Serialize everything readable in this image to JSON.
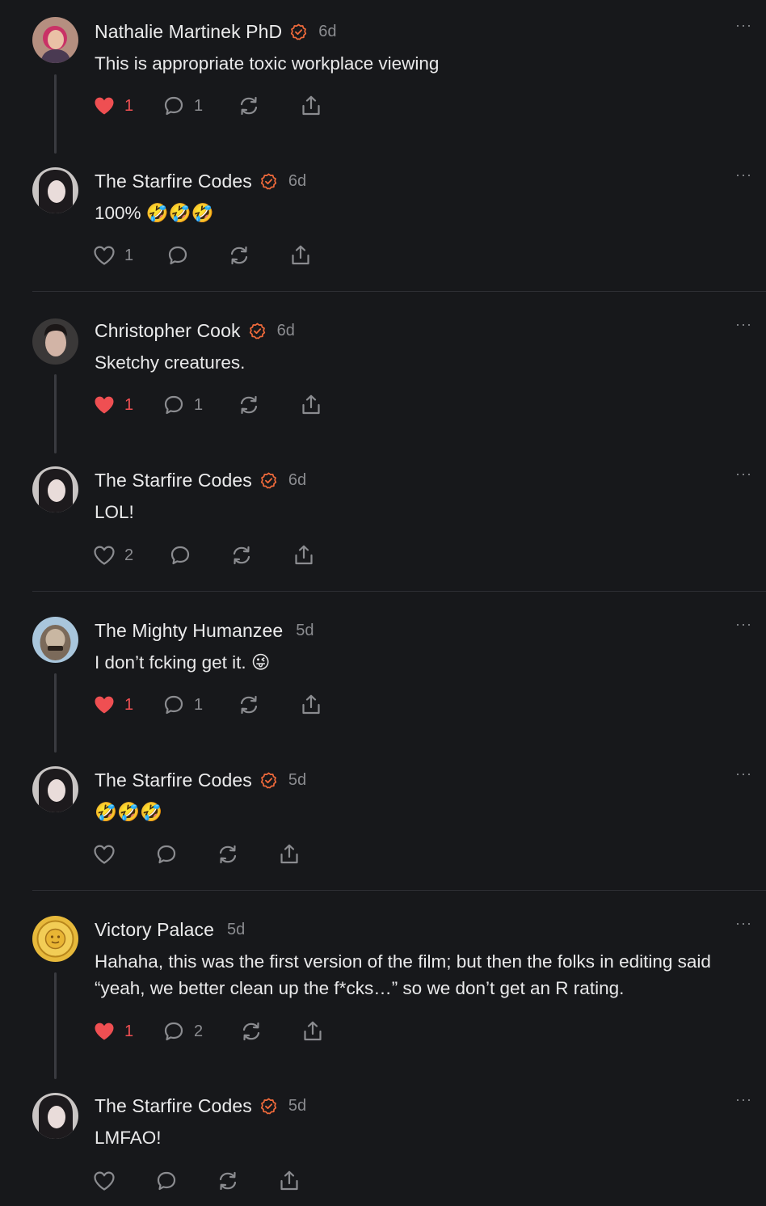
{
  "accent": "#f06a3b",
  "like_color": "#ef4f52",
  "comments": [
    {
      "author": "Nathalie Martinek PhD",
      "verified": true,
      "time": "6d",
      "text": "This is appropriate toxic workplace viewing",
      "liked": true,
      "likes": "1",
      "replies": "1"
    },
    {
      "author": "The Starfire Codes",
      "verified": true,
      "time": "6d",
      "text": "100% 🤣🤣🤣",
      "liked": false,
      "likes": "1",
      "replies": ""
    },
    {
      "author": "Christopher Cook",
      "verified": true,
      "time": "6d",
      "text": "Sketchy creatures.",
      "liked": true,
      "likes": "1",
      "replies": "1"
    },
    {
      "author": "The Starfire Codes",
      "verified": true,
      "time": "6d",
      "text": "LOL!",
      "liked": false,
      "likes": "2",
      "replies": ""
    },
    {
      "author": "The Mighty Humanzee",
      "verified": false,
      "time": "5d",
      "text": "I don’t fcking get it. 😜",
      "liked": true,
      "likes": "1",
      "replies": "1"
    },
    {
      "author": "The Starfire Codes",
      "verified": true,
      "time": "5d",
      "text": "🤣🤣🤣",
      "liked": false,
      "likes": "",
      "replies": ""
    },
    {
      "author": "Victory Palace",
      "verified": false,
      "time": "5d",
      "text": "Hahaha, this was the first version of the film; but then the folks in editing said “yeah, we better clean up the f*cks…” so we don’t get an R rating.",
      "liked": true,
      "likes": "1",
      "replies": "2"
    },
    {
      "author": "The Starfire Codes",
      "verified": true,
      "time": "5d",
      "text": "LMFAO!",
      "liked": false,
      "likes": "",
      "replies": ""
    }
  ],
  "more_label": "···"
}
